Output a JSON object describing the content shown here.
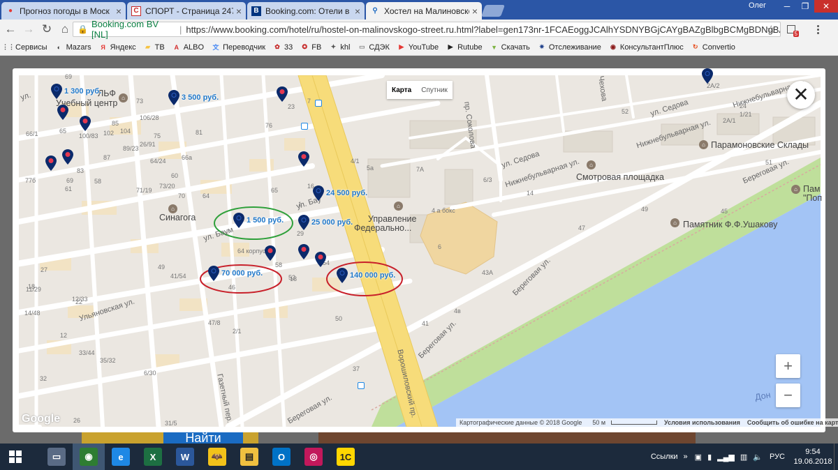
{
  "browser": {
    "tabs": [
      {
        "title": "Прогноз погоды в Моск",
        "icon": "weather-icon",
        "active": false
      },
      {
        "title": "СПОРТ - Страница 247",
        "icon": "sport-icon",
        "active": false
      },
      {
        "title": "Booking.com: Отели в Ро",
        "icon": "booking-icon",
        "active": false
      },
      {
        "title": "Хостел на Малиновского",
        "icon": "map-pin-icon",
        "active": true
      }
    ],
    "user": "Олег",
    "site_name": "Booking.com BV [NL]",
    "url": "https://www.booking.com/hotel/ru/hostel-on-malinovskogo-street.ru.html?label=gen173nr-1FCAEoggJCAlhYSDNYBGjCAYgBAZgBlbgBCMgBDNgBAe...",
    "bookmarks": [
      {
        "label": "Сервисы",
        "icon": "apps-icon",
        "color": "#4a4a4a"
      },
      {
        "label": "Mazars",
        "icon": "mazars-icon",
        "color": "#333"
      },
      {
        "label": "Яндекс",
        "icon": "yandex-icon",
        "color": "#e53935"
      },
      {
        "label": "ТВ",
        "icon": "folder-icon",
        "color": "#f6c342"
      },
      {
        "label": "ALBO",
        "icon": "albo-icon",
        "color": "#d32f2f"
      },
      {
        "label": "Переводчик",
        "icon": "translate-icon",
        "color": "#4285f4"
      },
      {
        "label": "33",
        "icon": "33-icon",
        "color": "#c62828"
      },
      {
        "label": "FB",
        "icon": "fb-icon",
        "color": "#c62828"
      },
      {
        "label": "khl",
        "icon": "khl-icon",
        "color": "#555"
      },
      {
        "label": "СДЭК",
        "icon": "page-icon",
        "color": "#888"
      },
      {
        "label": "YouTube",
        "icon": "youtube-icon",
        "color": "#e53935"
      },
      {
        "label": "Rutube",
        "icon": "play-icon",
        "color": "#222"
      },
      {
        "label": "Скачать",
        "icon": "android-icon",
        "color": "#7cb342"
      },
      {
        "label": "Отслеживание",
        "icon": "eagle-icon",
        "color": "#1e3f8a"
      },
      {
        "label": "КонсультантПлюс",
        "icon": "consultant-icon",
        "color": "#8b1a1a"
      },
      {
        "label": "Convertio",
        "icon": "convertio-icon",
        "color": "#e64a19"
      }
    ]
  },
  "page_behind": {
    "search_button": "Найти"
  },
  "map": {
    "type_toggle": {
      "map": "Карта",
      "satellite": "Спутник"
    },
    "price_pins": [
      {
        "price": "1 300 руб.",
        "circled": ""
      },
      {
        "price": "3 500 руб.",
        "circled": ""
      },
      {
        "price": "24 500 руб.",
        "circled": ""
      },
      {
        "price": "1 500 руб.",
        "circled": "green"
      },
      {
        "price": "25 000 руб.",
        "circled": ""
      },
      {
        "price": "70 000 руб.",
        "circled": "red"
      },
      {
        "price": "140 000 руб.",
        "circled": "red"
      }
    ],
    "place_labels": {
      "training_center": "Учебный центр",
      "lf": "ЛЬФ",
      "synagogue": "Синагога",
      "federal_office_1": "Управление",
      "federal_office_2": "Федерально...",
      "paramonov": "Парамоновские Склады",
      "observation": "Смотровая площадка",
      "ushakov": "Памятник Ф.Ф.Ушакову",
      "pam": "Пам",
      "pop": "\"Поп",
      "don": "Дон",
      "box": "4 а бокс",
      "korpus": "64 корпус"
    },
    "street_labels": {
      "sedova_1": "ул. Седова",
      "sedova_2": "ул. Седова",
      "nizhnebul_1": "Нижнебульварная ул.",
      "nizhnebul_2": "Нижнебульварная ул.",
      "nizhnebul_3": "Нижнебульварная ул.",
      "beregovaya_1": "Береговая ул.",
      "beregovaya_2": "Береговая ул.",
      "beregovaya_3": "Береговая ул.",
      "beregovaya_4": "Береговая ул.",
      "baumana_1": "ул. Баум",
      "baumana_2": "ул. Бау",
      "ulyanovskaya": "Ульяновская ул.",
      "sokolova": "пр. Соколова",
      "voroshilovsky": "Ворошиловский пр.",
      "gazetny": "Газетный пер.",
      "chekhova": "Чехова",
      "ul_left": "ул."
    },
    "numbers": [
      "69",
      "73",
      "106/28",
      "76",
      "23",
      "85",
      "75",
      "81",
      "102",
      "104",
      "66/1",
      "65",
      "100/83",
      "89/23",
      "64/24",
      "66а",
      "60",
      "87",
      "26/91",
      "69",
      "83",
      "77б",
      "61",
      "58",
      "71/19",
      "73/20",
      "70",
      "64",
      "65",
      "16",
      "1",
      "4/1",
      "5а",
      "7А",
      "6/3",
      "14",
      "51",
      "47",
      "49",
      "45",
      "6",
      "41",
      "37",
      "43А",
      "4в",
      "50",
      "52",
      "54",
      "58",
      "46",
      "47/8",
      "12/33",
      "18",
      "49",
      "41/54",
      "27",
      "11/29",
      "14/48",
      "22",
      "12",
      "33/44",
      "6/30",
      "35/32",
      "32",
      "26",
      "31/5",
      "2/1",
      "18",
      "29",
      "52",
      "24",
      "1/21",
      "2А/2",
      "2А/1",
      "7",
      "3",
      "6/30"
    ],
    "attribution": "Картографические данные © 2018 Google",
    "scale": "50 м",
    "terms": "Условия использования",
    "report": "Сообщить об ошибке на карте",
    "google": "Google"
  },
  "taskbar": {
    "apps": [
      "start-icon",
      "media-player-icon",
      "chrome-icon",
      "ie-icon",
      "excel-icon",
      "word-icon",
      "batman-icon",
      "file-explorer-icon",
      "outlook-icon",
      "tennis-icon",
      "1c-icon"
    ],
    "links_label": "Ссылки",
    "lang": "РУС",
    "time": "9:54",
    "date": "19.06.2018"
  },
  "colors": {
    "pin": "#0b2a6b",
    "price_text": "#1f77c8",
    "water": "#a3c4f5",
    "park": "#bfdf9b",
    "road_yellow": "#f7dc7a",
    "tabbar": "#2b56a6"
  }
}
